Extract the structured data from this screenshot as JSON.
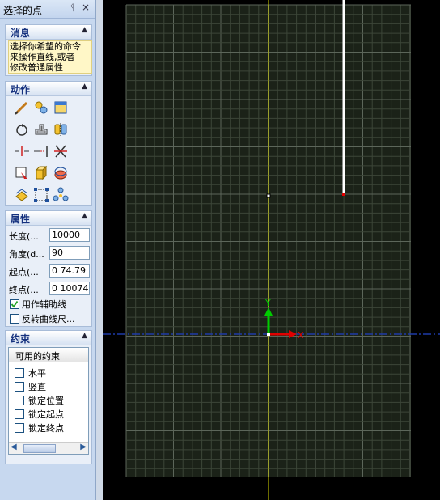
{
  "panel": {
    "title": "选择的点",
    "pin_icon": "pin-icon",
    "close_icon": "close-icon"
  },
  "message": {
    "header": "消息",
    "text_lines": [
      "选择你希望的命令",
      "来操作直线,或者",
      "修改普通属性"
    ]
  },
  "actions": {
    "header": "动作",
    "tools": [
      "line-edit-icon",
      "select-icon",
      "window-icon",
      "rotate-icon",
      "offset-icon",
      "mirror-icon",
      "trim-icon",
      "extend-icon",
      "cut-icon",
      "trim-corner-icon",
      "extrude-icon",
      "revolve-icon",
      "flip-icon",
      "move-points-icon",
      "array-icon"
    ]
  },
  "properties": {
    "header": "属性",
    "length_label": "长度(...",
    "length_value": "10000",
    "angle_label": "角度(d...",
    "angle_value": "90",
    "start_label": "起点(...",
    "start_value": "0 74.79",
    "end_label": "终点(...",
    "end_value": "0 10074",
    "aux_label": "用作辅助线",
    "aux_checked": true,
    "reverse_label": "反转曲线尺...",
    "reverse_checked": false
  },
  "constraints": {
    "header": "约束",
    "list_header": "可用的约束",
    "items": [
      "水平",
      "竖直",
      "锁定位置",
      "锁定起点",
      "锁定终点"
    ]
  },
  "canvas": {
    "y_axis_label": "Y",
    "x_axis_label": "X",
    "colors": {
      "background": "#000000",
      "grid_bg": "#1b2218",
      "grid_line": "#3c4638",
      "grid_major": "#5c665a",
      "vertical_axis": "#d8d800",
      "horizontal_axis": "#1e3aa8",
      "y_arrow": "#00cc00",
      "x_arrow": "#e00000",
      "selected_line": "#ffffff"
    }
  }
}
